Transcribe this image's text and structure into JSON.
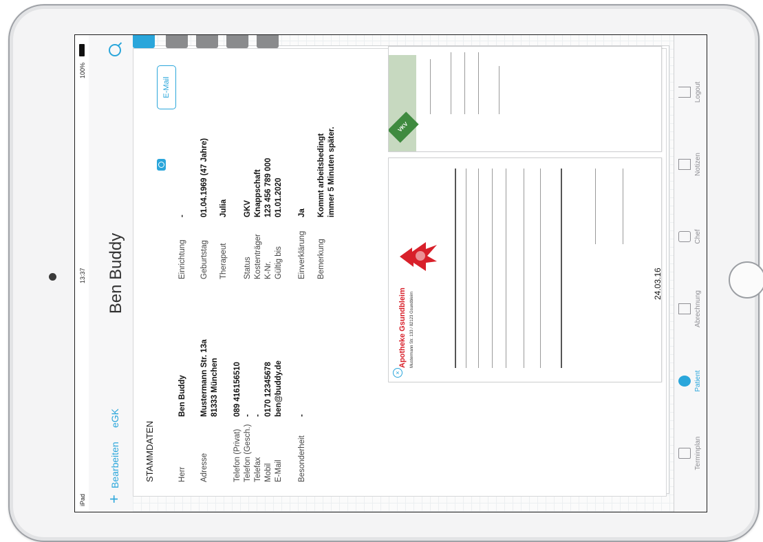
{
  "statusbar": {
    "carrier": "iPad",
    "time": "13:37",
    "battery": "100%"
  },
  "navbar": {
    "edit_label": "Bearbeiten",
    "egk_label": "eGK",
    "title": "Ben Buddy"
  },
  "stammdaten": {
    "section_title": "STAMMDATEN",
    "email_button": "E-Mail",
    "anrede_label": "Herr",
    "anrede_value": "Ben Buddy",
    "adresse_label": "Adresse",
    "adresse_line1": "Mustermann Str. 13a",
    "adresse_line2": "81333 München",
    "tel_privat_label": "Telefon (Privat)",
    "tel_privat_value": "089 416156510",
    "tel_gesch_label": "Telefon (Gesch.)",
    "tel_gesch_value": "-",
    "telefax_label": "Telefax",
    "telefax_value": "-",
    "mobil_label": "Mobil",
    "mobil_value": "0170 12345678",
    "email_label": "E-Mail",
    "email_value": "ben@buddy.de",
    "besonderheit_label": "Besonderheit",
    "besonderheit_value": "-",
    "einrichtung_label": "Einrichtung",
    "einrichtung_value": "-",
    "geburtstag_label": "Geburtstag",
    "geburtstag_value": "01.04.1969 (47 Jahre)",
    "therapeut_label": "Therapeut",
    "therapeut_value": "Julia",
    "status_label": "Status",
    "status_value": "GKV",
    "kostentraeger_label": "Kostenträger",
    "kostentraeger_value": "Knappschaft",
    "knr_label": "K-Nr.",
    "knr_value": "123 456 789 000",
    "gueltig_label": "Gültig bis",
    "gueltig_value": "01.01.2020",
    "einverstaendnis_label": "Einverklärung",
    "einverstaendnis_value": "Ja",
    "bemerkung_label": "Bemerkung",
    "bemerkung_line1": "Kommt arbeitsbedingt",
    "bemerkung_line2": "immer 5 Minuten später."
  },
  "documents": {
    "apotheke_name": "Apotheke Gsundbleim",
    "apotheke_address": "Mustermann Str. 133 / 82123 Gsundbleim",
    "date": "24.03.16"
  },
  "tabs": [
    {
      "label": "Terminplan",
      "icon": "calendar-icon"
    },
    {
      "label": "Patient",
      "icon": "person-icon"
    },
    {
      "label": "Abrechnung",
      "icon": "invoice-icon"
    },
    {
      "label": "Chef",
      "icon": "lock-icon"
    },
    {
      "label": "Notizen",
      "icon": "notes-icon"
    },
    {
      "label": "Logout",
      "icon": "logout-icon"
    }
  ],
  "colors": {
    "accent": "#2aa6db",
    "apotheke_red": "#d8202a",
    "vkv_green": "#3f8a3f"
  }
}
